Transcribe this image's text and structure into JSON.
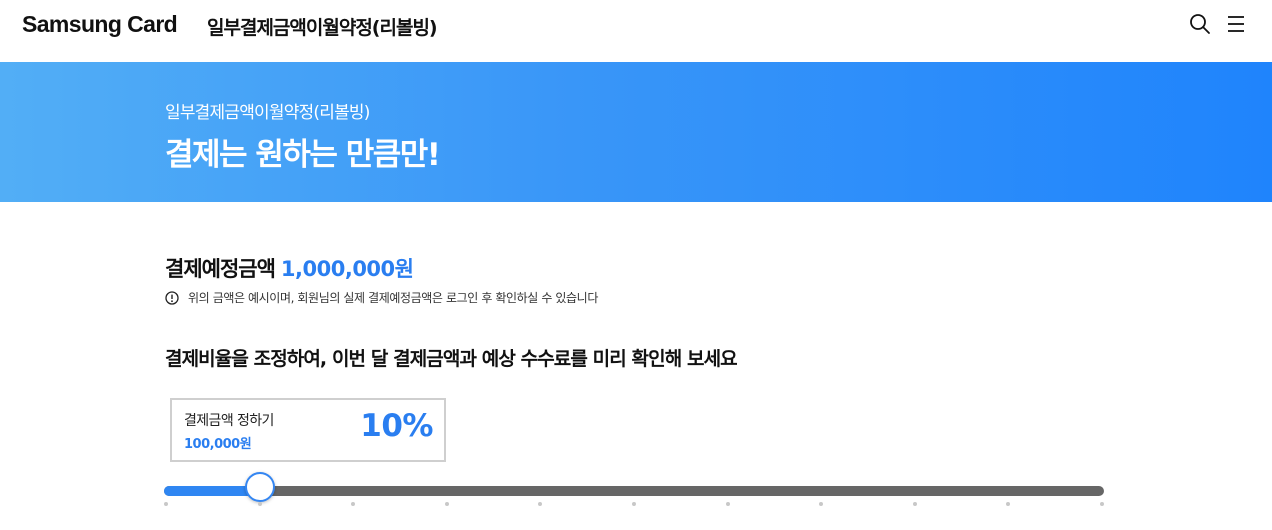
{
  "header": {
    "logo": "Samsung Card",
    "title": "일부결제금액이월약정(리볼빙)",
    "icons": [
      "search-icon",
      "menu-icon"
    ]
  },
  "banner": {
    "subtitle": "일부결제금액이월약정(리볼빙)",
    "title": "결제는 원하는 만큼만!"
  },
  "amount": {
    "label": "결제예정금액",
    "value": "1,000,000원"
  },
  "notice": {
    "icon": "info-icon",
    "text": "위의 금액은 예시이며, 회원님의 실제 결제예정금액은 로그인 후 확인하실 수 있습니다"
  },
  "guide": "결제비율을 조정하여, 이번 달 결제금액과 예상 수수료를 미리 확인해 보세요",
  "rate_box": {
    "label": "결제금액 정하기",
    "amount": "100,000원",
    "percent": "10%"
  },
  "slider": {
    "value": 0.1,
    "steps": 10
  },
  "colors": {
    "accent": "#2a7ef0",
    "banner_start": "#52aef6",
    "banner_end": "#1f84fc",
    "track": "#666666"
  }
}
